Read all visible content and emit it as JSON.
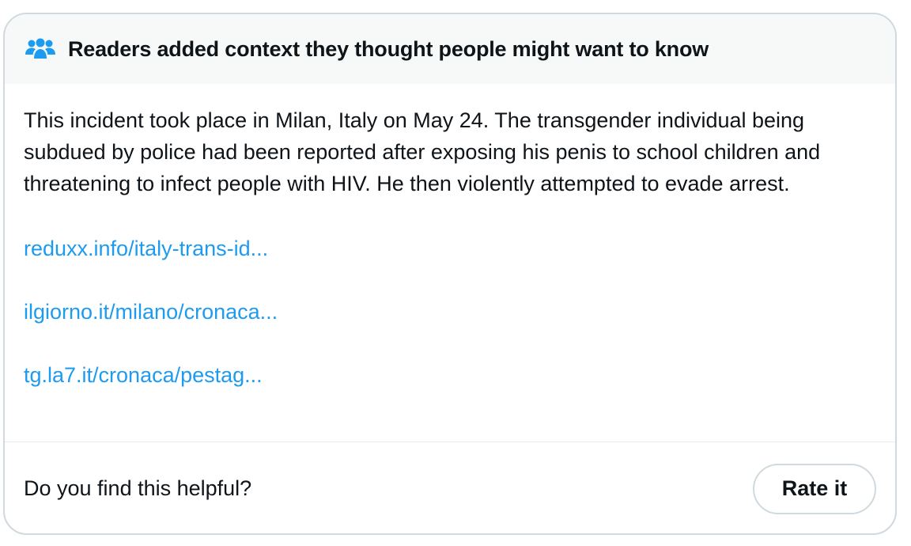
{
  "header": {
    "icon": "people-group-icon",
    "title": "Readers added context they thought people might want to know"
  },
  "note": {
    "text": "This incident took place in Milan, Italy on May 24. The transgender individual being subdued by police had been reported after exposing his penis to school children and threatening to infect people with HIV. He then violently attempted to evade arrest."
  },
  "links": [
    {
      "label": "reduxx.info/italy-trans-id..."
    },
    {
      "label": "ilgiorno.it/milano/cronaca..."
    },
    {
      "label": "tg.la7.it/cronaca/pestag..."
    }
  ],
  "footer": {
    "question": "Do you find this helpful?",
    "rate_label": "Rate it"
  },
  "colors": {
    "link": "#1d9bf0",
    "header_bg": "#f7f9f9",
    "border": "#cfd9de",
    "text": "#0f1419"
  }
}
